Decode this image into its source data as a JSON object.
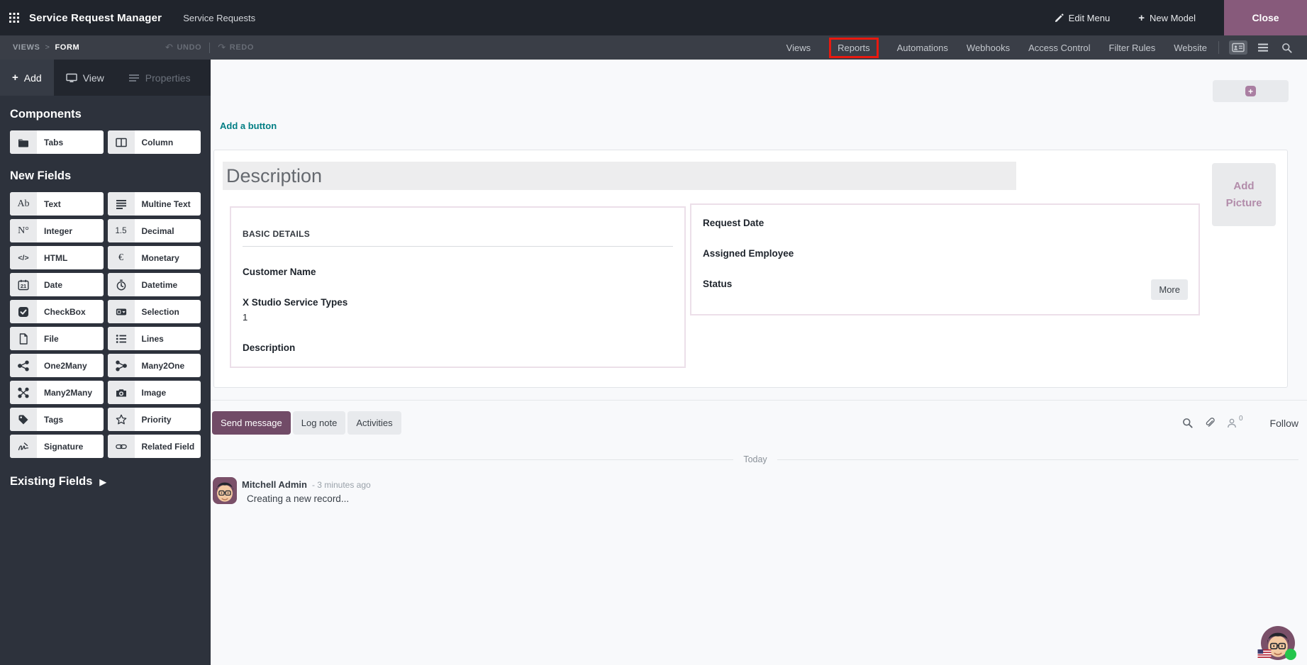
{
  "topbar": {
    "app_title": "Service Request Manager",
    "menu_item": "Service Requests",
    "edit_menu_label": "Edit Menu",
    "new_model_label": "New Model",
    "close_label": "Close"
  },
  "toolbar": {
    "breadcrumb_root": "VIEWS",
    "breadcrumb_current": "FORM",
    "undo_label": "UNDO",
    "redo_label": "REDO",
    "tabs": [
      {
        "label": "Views"
      },
      {
        "label": "Reports",
        "highlighted": true
      },
      {
        "label": "Automations"
      },
      {
        "label": "Webhooks"
      },
      {
        "label": "Access Control"
      },
      {
        "label": "Filter Rules"
      },
      {
        "label": "Website"
      }
    ],
    "highlight_color": "#e9190f"
  },
  "sidebar": {
    "tabs": [
      {
        "label": "Add",
        "icon": "plus-icon",
        "state": "active"
      },
      {
        "label": "View",
        "icon": "monitor-icon",
        "state": "normal"
      },
      {
        "label": "Properties",
        "icon": "properties-icon",
        "state": "disabled"
      }
    ],
    "sections": [
      {
        "title": "Components",
        "items": [
          {
            "label": "Tabs",
            "icon": "tabs-icon",
            "glyph_svg": "tabs"
          },
          {
            "label": "Column",
            "icon": "column-icon",
            "glyph_svg": "column"
          }
        ]
      },
      {
        "title": "New Fields",
        "items": [
          {
            "label": "Text",
            "icon": "text-icon",
            "glyph_text": "Ab"
          },
          {
            "label": "Multine Text",
            "icon": "multiline-text-icon",
            "glyph_svg": "multiline"
          },
          {
            "label": "Integer",
            "icon": "integer-icon",
            "glyph_text": "N°"
          },
          {
            "label": "Decimal",
            "icon": "decimal-icon",
            "glyph_text": "1.5"
          },
          {
            "label": "HTML",
            "icon": "html-icon",
            "glyph_text": "</>"
          },
          {
            "label": "Monetary",
            "icon": "monetary-icon",
            "glyph_text": "€"
          },
          {
            "label": "Date",
            "icon": "date-icon",
            "glyph_svg": "date"
          },
          {
            "label": "Datetime",
            "icon": "datetime-icon",
            "glyph_svg": "datetime"
          },
          {
            "label": "CheckBox",
            "icon": "checkbox-icon",
            "glyph_svg": "checkbox"
          },
          {
            "label": "Selection",
            "icon": "selection-icon",
            "glyph_svg": "selection"
          },
          {
            "label": "File",
            "icon": "file-icon",
            "glyph_svg": "file"
          },
          {
            "label": "Lines",
            "icon": "lines-icon",
            "glyph_svg": "lines"
          },
          {
            "label": "One2Many",
            "icon": "one2many-icon",
            "glyph_svg": "o2m"
          },
          {
            "label": "Many2One",
            "icon": "many2one-icon",
            "glyph_svg": "m2o"
          },
          {
            "label": "Many2Many",
            "icon": "many2many-icon",
            "glyph_svg": "m2m"
          },
          {
            "label": "Image",
            "icon": "image-icon",
            "glyph_svg": "camera"
          },
          {
            "label": "Tags",
            "icon": "tag-icon",
            "glyph_svg": "tag"
          },
          {
            "label": "Priority",
            "icon": "priority-star-icon",
            "glyph_svg": "star"
          },
          {
            "label": "Signature",
            "icon": "signature-icon",
            "glyph_svg": "signature"
          },
          {
            "label": "Related Field",
            "icon": "related-field-icon",
            "glyph_svg": "link"
          }
        ]
      }
    ],
    "existing_fields_label": "Existing Fields"
  },
  "canvas": {
    "add_button_label": "Add a button",
    "form": {
      "title": "Description",
      "add_picture_label": "Add Picture",
      "left_group": {
        "header": "BASIC DETAILS",
        "fields": [
          {
            "label": "Customer Name"
          },
          {
            "label": "X Studio Service Types",
            "value": "1"
          },
          {
            "label": "Description"
          }
        ]
      },
      "right_group": {
        "fields": [
          {
            "label": "Request Date"
          },
          {
            "label": "Assigned Employee"
          },
          {
            "label": "Status"
          }
        ],
        "more_label": "More"
      }
    },
    "chatter": {
      "send_message_label": "Send message",
      "log_note_label": "Log note",
      "activities_label": "Activities",
      "followers_count": "0",
      "follow_label": "Follow",
      "date_divider": "Today",
      "message": {
        "author": "Mitchell Admin",
        "timestamp": "- 3 minutes ago",
        "body": "Creating a new record..."
      }
    }
  },
  "colors": {
    "brand_purple": "#714b67",
    "close_button": "#875a7b",
    "teal_link": "#017e84",
    "highlight_red": "#e9190f",
    "mauve_accent": "#b28caa",
    "online_green": "#24c54c"
  }
}
